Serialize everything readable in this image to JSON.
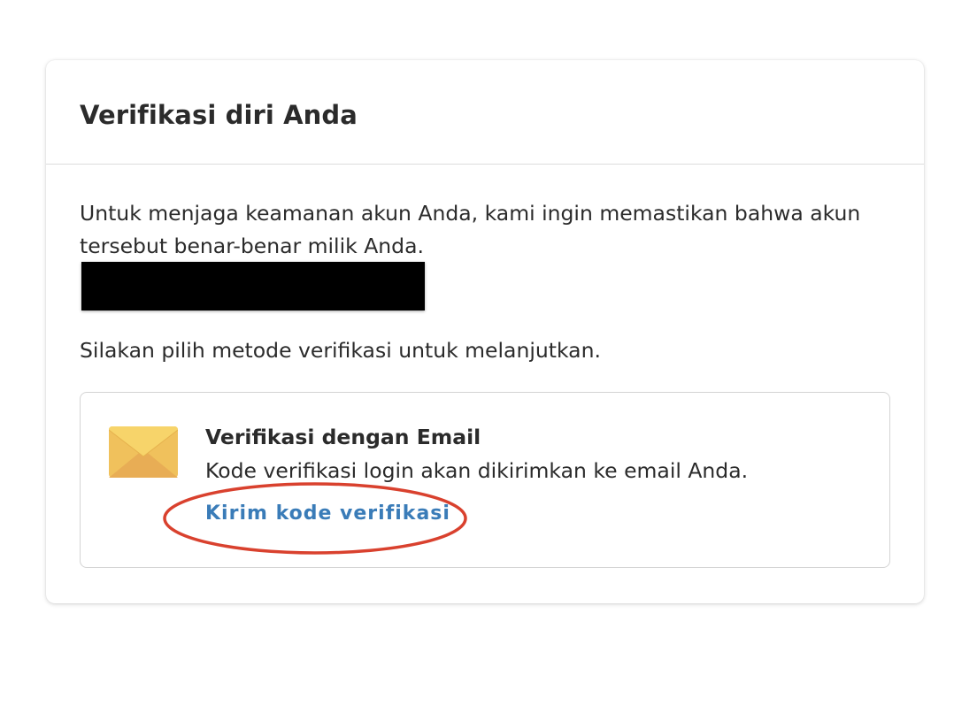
{
  "card": {
    "title": "Verifikasi diri Anda",
    "intro": "Untuk menjaga keamanan akun Anda, kami ingin memastikan bahwa akun tersebut benar-benar milik Anda.",
    "instruction": "Silakan pilih metode verifikasi untuk melanjutkan."
  },
  "option": {
    "icon": "envelope-icon",
    "title": "Verifikasi dengan Email",
    "description": "Kode verifikasi login akan dikirimkan ke email Anda.",
    "link_label": "Kirim kode verifikasi"
  },
  "colors": {
    "link": "#3a7cb8",
    "annotation": "#d9412e",
    "envelope_light": "#f5cf63",
    "envelope_dark": "#e9a94f"
  }
}
